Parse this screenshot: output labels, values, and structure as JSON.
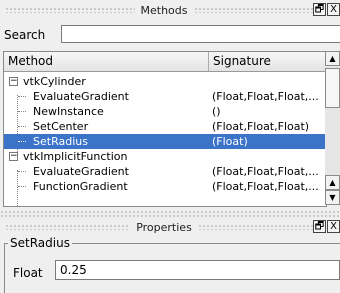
{
  "methods_panel": {
    "title": "Methods",
    "search": {
      "label": "Search",
      "value": ""
    },
    "columns": {
      "method": "Method",
      "signature": "Signature"
    },
    "rows": [
      {
        "name": "vtkCylinder",
        "signature": "",
        "level": 0,
        "expander": "−"
      },
      {
        "name": "EvaluateGradient",
        "signature": "(Float,Float,Float,...",
        "level": 1
      },
      {
        "name": "NewInstance",
        "signature": "()",
        "level": 1
      },
      {
        "name": "SetCenter",
        "signature": "(Float,Float,Float)",
        "level": 1
      },
      {
        "name": "SetRadius",
        "signature": "(Float)",
        "level": 1,
        "selected": true
      },
      {
        "name": "vtkImplicitFunction",
        "signature": "",
        "level": 0,
        "expander": "−"
      },
      {
        "name": "EvaluateGradient",
        "signature": "(Float,Float,Float,...",
        "level": 1
      },
      {
        "name": "FunctionGradient",
        "signature": "(Float,Float,Float,...",
        "level": 1
      }
    ],
    "float_button": "🗗",
    "close_button": "X"
  },
  "properties_panel": {
    "title": "Properties",
    "group_title": "SetRadius",
    "field_label": "Float",
    "field_value": "0.25",
    "float_button": "🗗",
    "close_button": "X"
  },
  "colors": {
    "selection": "#3a73c8",
    "background": "#efefef"
  }
}
